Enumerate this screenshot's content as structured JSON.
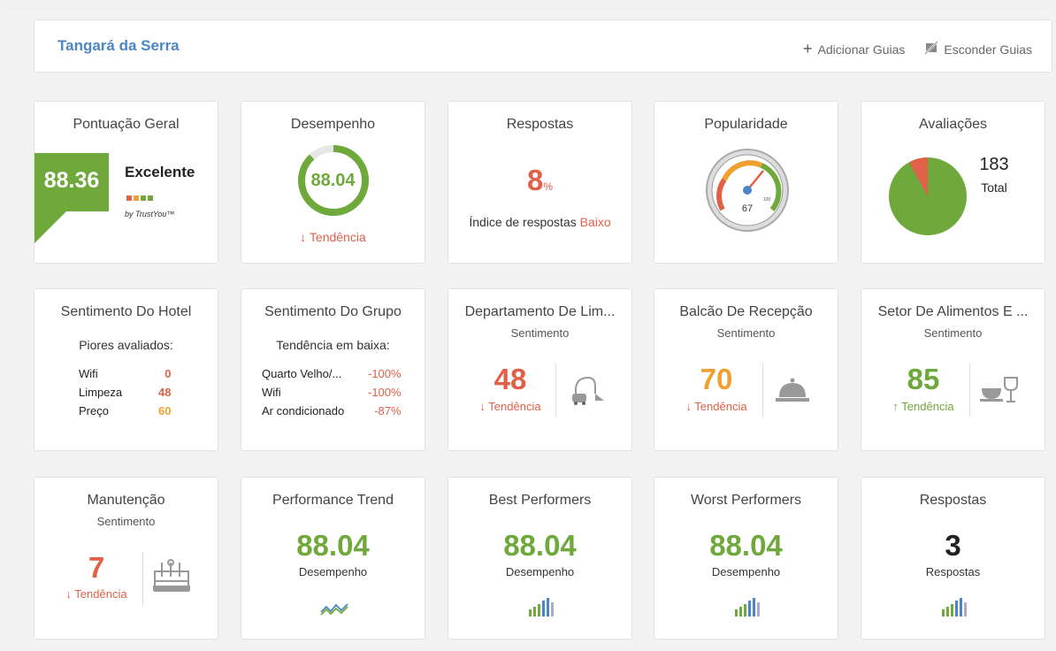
{
  "header": {
    "title": "Tangará da Serra",
    "add_label": "Adicionar Guias",
    "hide_label": "Esconder Guias"
  },
  "row1": {
    "score": {
      "title": "Pontuação Geral",
      "value": "88.36",
      "label": "Excelente",
      "brand": "by TrustYou™"
    },
    "performance": {
      "title": "Desempenho",
      "value": "88.04",
      "trend": "↓ Tendência",
      "gauge_fraction": 0.8804
    },
    "responses": {
      "title": "Respostas",
      "value": "8",
      "unit": "%",
      "index_label": "Índice de respostas",
      "index_value": "Baixo"
    },
    "popularity": {
      "title": "Popularidade",
      "value": "67",
      "scale_max": "100"
    },
    "reviews": {
      "title": "Avaliações",
      "total": "183",
      "total_label": "Total",
      "red_fraction": 0.08
    }
  },
  "row2": {
    "hotel": {
      "title": "Sentimento Do Hotel",
      "subtitle": "Piores avaliados:",
      "rows": [
        {
          "label": "Wifi",
          "value": "0",
          "color": "#e06048"
        },
        {
          "label": "Limpeza",
          "value": "48",
          "color": "#e06048"
        },
        {
          "label": "Preço",
          "value": "60",
          "color": "#f0a030"
        }
      ]
    },
    "group": {
      "title": "Sentimento Do Grupo",
      "subtitle": "Tendência em baixa:",
      "rows": [
        {
          "label": "Quarto Velho/...",
          "value": "-100%"
        },
        {
          "label": "Wifi",
          "value": "-100%"
        },
        {
          "label": "Ar condicionado",
          "value": "-87%"
        }
      ]
    },
    "cleaning": {
      "title": "Departamento De Lim...",
      "subtitle": "Sentimento",
      "value": "48",
      "trend": "↓ Tendência",
      "icon": "vacuum-icon"
    },
    "reception": {
      "title": "Balcão De Recepção",
      "subtitle": "Sentimento",
      "value": "70",
      "trend": "↓ Tendência",
      "icon": "bell-icon"
    },
    "food": {
      "title": "Setor De Alimentos E ...",
      "subtitle": "Sentimento",
      "value": "85",
      "trend": "↑ Tendência",
      "icon": "dining-icon"
    }
  },
  "row3": {
    "maintenance": {
      "title": "Manutenção",
      "subtitle": "Sentimento",
      "value": "7",
      "trend": "↓ Tendência",
      "icon": "toolbox-icon"
    },
    "perf_trend": {
      "title": "Performance Trend",
      "value": "88.04",
      "label": "Desempenho",
      "icon": "trend-icon"
    },
    "best": {
      "title": "Best Performers",
      "value": "88.04",
      "label": "Desempenho",
      "icon": "bars-icon"
    },
    "worst": {
      "title": "Worst Performers",
      "value": "88.04",
      "label": "Desempenho",
      "icon": "bars-icon"
    },
    "responses": {
      "title": "Respostas",
      "value": "3",
      "label": "Respostas",
      "icon": "bars-icon"
    }
  },
  "colors": {
    "green": "#6fa93c",
    "red": "#e06048",
    "orange": "#f0a030",
    "blue": "#4a86c5"
  }
}
